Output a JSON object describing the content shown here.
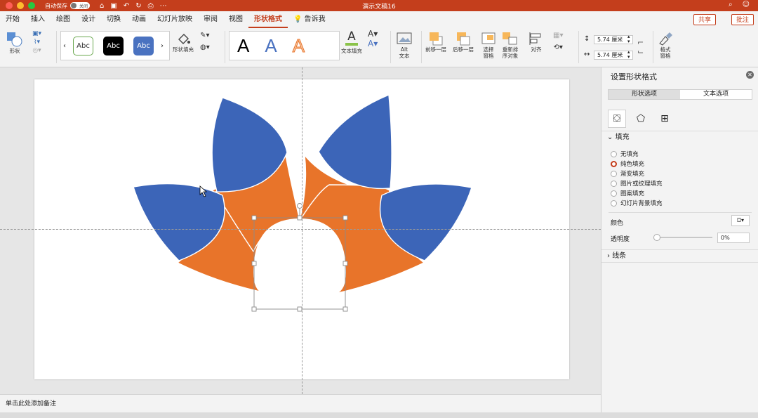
{
  "titlebar": {
    "autosave_label": "自动保存",
    "autosave_state": "关闭",
    "doc_title": "演示文稿16"
  },
  "tabs": [
    "开始",
    "插入",
    "绘图",
    "设计",
    "切换",
    "动画",
    "幻灯片放映",
    "审阅",
    "视图",
    "形状格式",
    "告诉我"
  ],
  "active_tab": "形状格式",
  "actions": {
    "share": "共享",
    "comment": "批注"
  },
  "ribbon": {
    "shape": "形状",
    "style_samples": [
      "Abc",
      "Abc",
      "Abc"
    ],
    "shape_fill": "形状填充",
    "wordart_samples": [
      "A",
      "A",
      "A"
    ],
    "text_fill": "文本填充",
    "alt_text": "Alt\n文本",
    "bring_forward": "前移一层",
    "send_backward": "后移一层",
    "selection_pane": "选择\n窗格",
    "reorder": "重新排\n序对象",
    "align": "对齐",
    "height": "5.74 厘米",
    "width": "5.74 厘米",
    "format_pane": "格式\n窗格"
  },
  "notes_placeholder": "单击此处添加备注",
  "pane": {
    "title": "设置形状格式",
    "tab_shape": "形状选项",
    "tab_text": "文本选项",
    "fill_header": "填充",
    "fill_options": [
      "无填充",
      "纯色填充",
      "渐变填充",
      "图片或纹理填充",
      "图案填充",
      "幻灯片背景填充"
    ],
    "fill_selected": "纯色填充",
    "color_label": "颜色",
    "transparency_label": "透明度",
    "transparency_value": "0%",
    "line_header": "线条"
  },
  "colors": {
    "accent": "#c43e1c",
    "petal_blue": "#3c65b8",
    "petal_orange": "#e8742a"
  }
}
